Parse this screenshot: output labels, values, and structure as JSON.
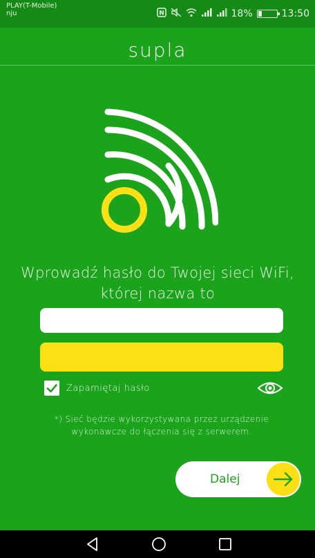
{
  "status_bar": {
    "carrier_line1": "PLAY(T-Mobile)",
    "carrier_line2": "nju",
    "battery_percent": "18%",
    "battery_level": 0.18,
    "time": "13:50",
    "icons": [
      "nfc-icon",
      "mute-icon",
      "wifi-icon",
      "signal-icon",
      "signal-icon-2",
      "battery-icon"
    ]
  },
  "header": {
    "title": "supla"
  },
  "main": {
    "prompt": "Wprowadź hasło do Twojej sieci WiFi, której nazwa to",
    "ssid_value": "",
    "password_value": "",
    "remember_label": "Zapamiętaj hasło",
    "remember_checked": true,
    "info": "*) Sieć będzie wykorzystywana przez urządzenie wykonawcze do łączenia się z serwerem.",
    "next_label": "Dalej"
  },
  "colors": {
    "background": "#1ca31c",
    "accent_yellow": "#fbe016",
    "white": "#ffffff"
  }
}
